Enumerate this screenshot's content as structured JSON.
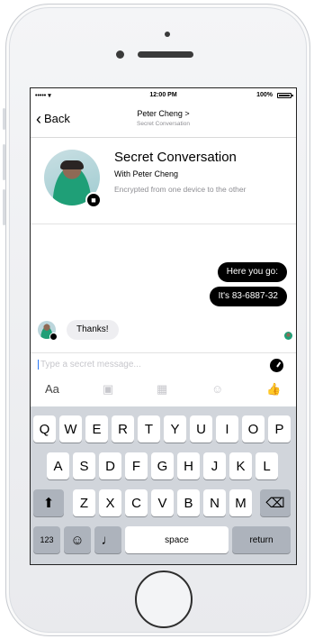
{
  "status_bar": {
    "carrier": "••••• ▾",
    "time": "12:00 PM",
    "battery": "100%"
  },
  "nav": {
    "back_label": "Back",
    "back_chevron": "‹",
    "title": "Peter Cheng >",
    "subtitle": "Secret Conversation"
  },
  "header": {
    "title": "Secret Conversation",
    "with_line": "With Peter Cheng",
    "encryption_note": "Encrypted from one device to the other",
    "lock_glyph": "■"
  },
  "messages": {
    "outgoing": [
      "Here you go:",
      "It's 83-6887-32"
    ],
    "incoming": [
      "Thanks!"
    ]
  },
  "composer": {
    "placeholder": "Type a secret message...",
    "value": ""
  },
  "toolbar": {
    "text_style": "Aa",
    "camera": "▣",
    "gallery": "▦",
    "emoji": "☺",
    "like": "👍"
  },
  "keyboard": {
    "row1": [
      "Q",
      "W",
      "E",
      "R",
      "T",
      "Y",
      "U",
      "I",
      "O",
      "P"
    ],
    "row2": [
      "A",
      "S",
      "D",
      "F",
      "G",
      "H",
      "J",
      "K",
      "L"
    ],
    "row3": [
      "Z",
      "X",
      "C",
      "V",
      "B",
      "N",
      "M"
    ],
    "shift": "⬆",
    "delete": "⌫",
    "numbers": "123",
    "emoji_key": "☺",
    "mic": "♩",
    "space": "space",
    "return": "return"
  },
  "colors": {
    "accent": "#2f7bf5",
    "outgoing_bubble": "#000000",
    "incoming_bubble": "#eeeef1",
    "keyboard_bg": "#d1d5db"
  }
}
